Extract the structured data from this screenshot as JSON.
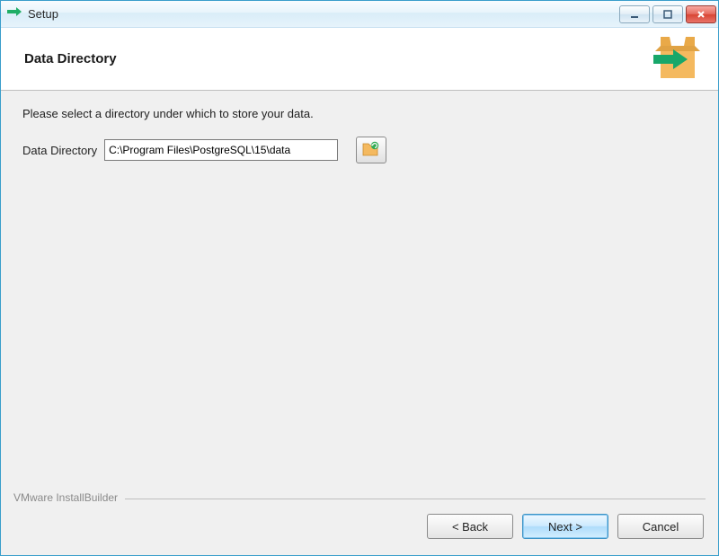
{
  "window": {
    "title": "Setup"
  },
  "header": {
    "title": "Data Directory"
  },
  "content": {
    "instruction": "Please select a directory under which to store your data.",
    "field_label": "Data Directory",
    "directory_value": "C:\\Program Files\\PostgreSQL\\15\\data"
  },
  "footer": {
    "brand": "VMware InstallBuilder",
    "back_label": "< Back",
    "next_label": "Next >",
    "cancel_label": "Cancel"
  }
}
